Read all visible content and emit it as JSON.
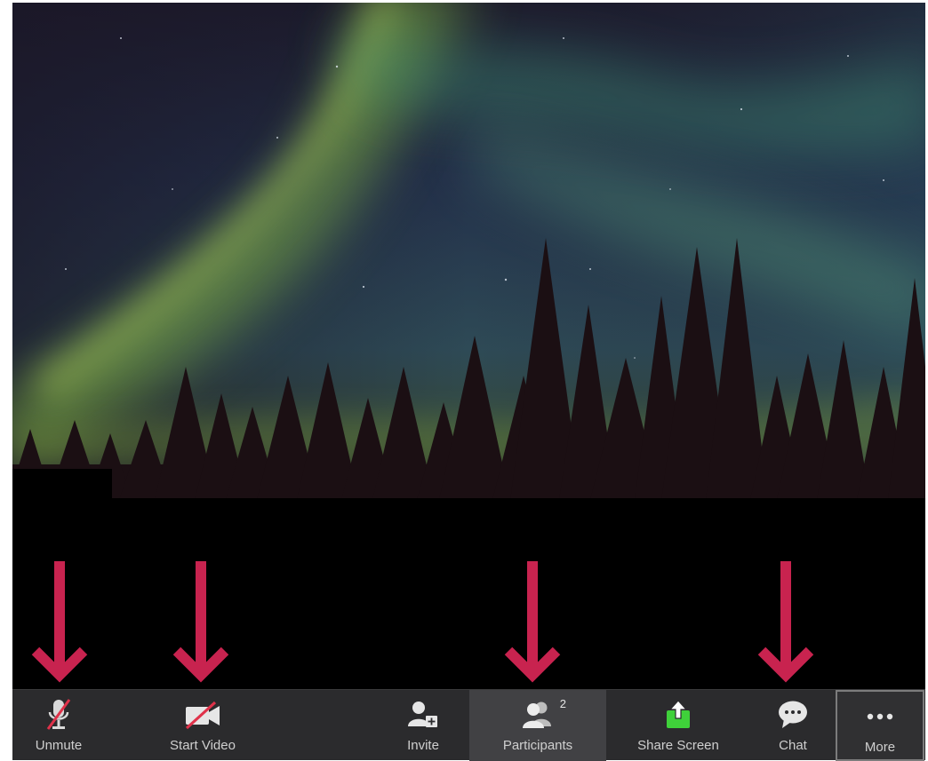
{
  "toolbar": {
    "buttons": [
      {
        "id": "unmute",
        "label": "Unmute",
        "icon": "microphone-muted-icon"
      },
      {
        "id": "start-video",
        "label": "Start Video",
        "icon": "video-off-icon"
      },
      {
        "id": "invite",
        "label": "Invite",
        "icon": "invite-user-icon"
      },
      {
        "id": "participants",
        "label": "Participants",
        "icon": "participants-icon",
        "badge": "2"
      },
      {
        "id": "share-screen",
        "label": "Share Screen",
        "icon": "share-screen-icon"
      },
      {
        "id": "chat",
        "label": "Chat",
        "icon": "chat-bubble-icon"
      },
      {
        "id": "more",
        "label": "More",
        "icon": "more-dots-icon"
      }
    ],
    "audio_options_icon": "caret-up-icon"
  },
  "annotations": {
    "arrow_color": "#c8234f",
    "arrow_targets": [
      "unmute",
      "start-video",
      "participants",
      "chat"
    ]
  },
  "colors": {
    "toolbar_bg": "#2b2b2d",
    "muted_red": "#e0324a",
    "share_green": "#3fd13a"
  }
}
